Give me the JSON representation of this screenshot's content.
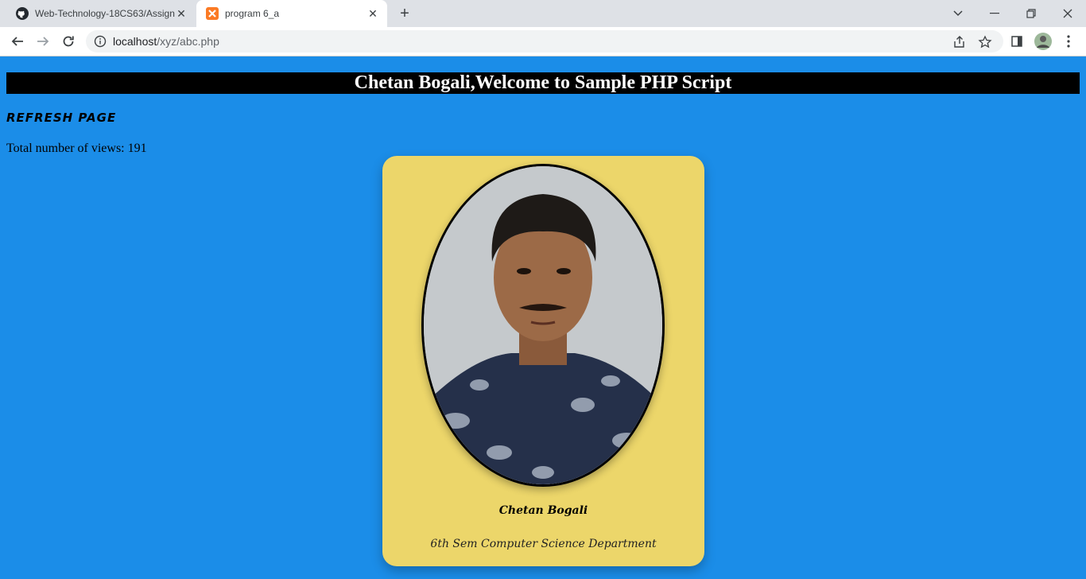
{
  "browser": {
    "tabs": [
      {
        "title": "Web-Technology-18CS63/Assignm",
        "favicon": "github-icon",
        "active": false
      },
      {
        "title": "program 6_a",
        "favicon": "xampp-icon",
        "active": true
      }
    ],
    "address": {
      "host": "localhost",
      "path": "/xyz/abc.php"
    }
  },
  "page": {
    "heading": "Chetan Bogali,Welcome to Sample PHP Script",
    "refresh_label": "Refresh Page",
    "views_text": "Total number of views: 191",
    "card": {
      "name": "Chetan Bogali",
      "department": "6th Sem Computer Science Department"
    }
  },
  "colors": {
    "page_background": "#1b8de8",
    "header_background": "#000000",
    "card_background": "#ecd66a"
  }
}
